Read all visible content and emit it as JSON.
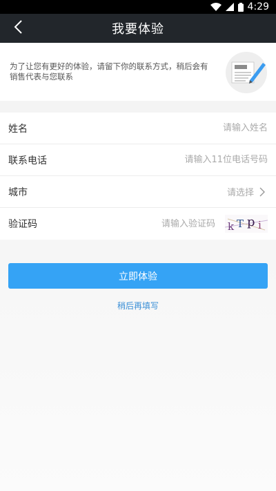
{
  "status_bar": {
    "time": "4:29"
  },
  "header": {
    "title": "我要体验"
  },
  "intro": {
    "text": "为了让您有更好的体验，请留下你的联系方式，稍后会有销售代表与您联系"
  },
  "form": {
    "name": {
      "label": "姓名",
      "placeholder": "请输入姓名"
    },
    "phone": {
      "label": "联系电话",
      "placeholder": "请输入11位电话号码"
    },
    "city": {
      "label": "城市",
      "placeholder": "请选择"
    },
    "code": {
      "label": "验证码",
      "placeholder": "请输入验证码",
      "captcha_text": "kTpi"
    }
  },
  "actions": {
    "submit": "立即体验",
    "later": "稍后再填写"
  },
  "colors": {
    "nav_bg": "#22262b",
    "accent": "#35a3f5",
    "link": "#3a8fd6"
  }
}
